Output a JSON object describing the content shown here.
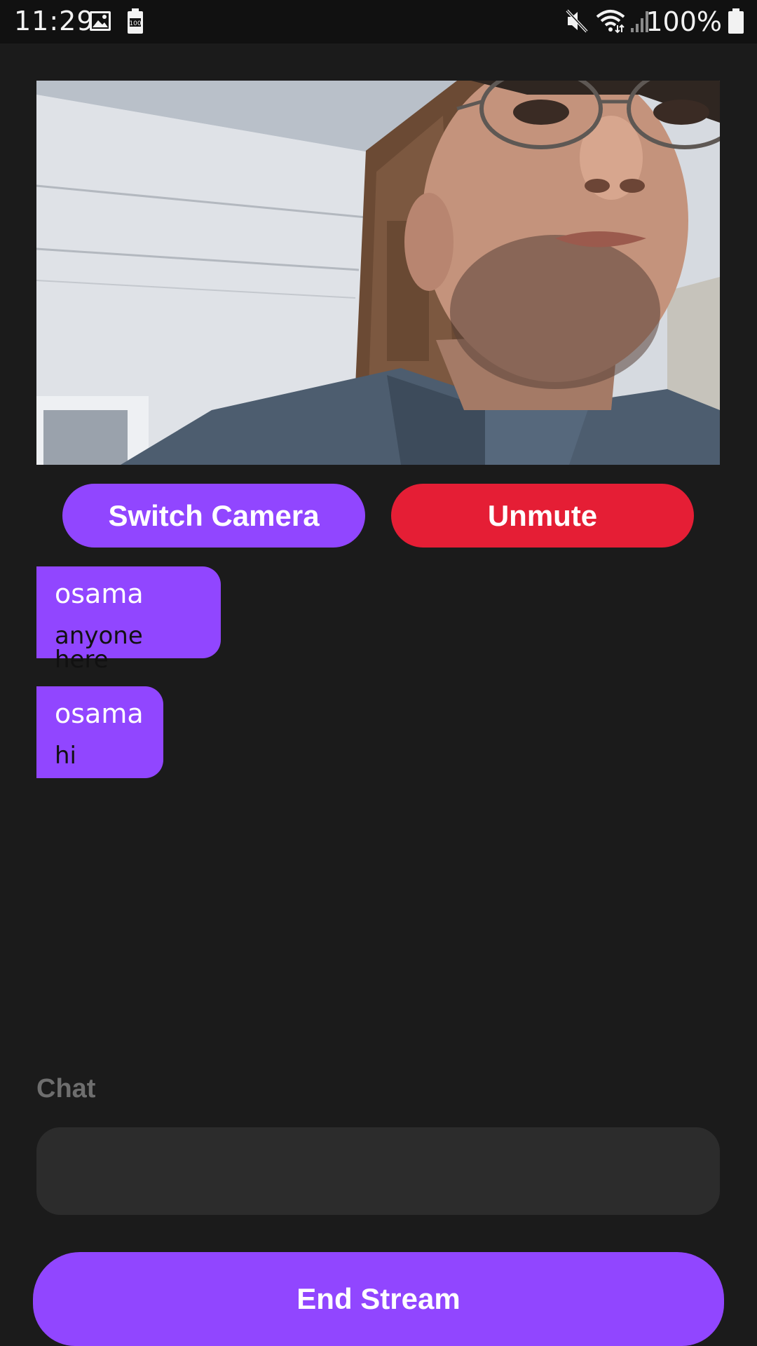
{
  "status_bar": {
    "time": "11:29",
    "battery_text": "100%",
    "icons": [
      "image-icon",
      "battery-saver-icon",
      "mute-icon",
      "wifi-icon",
      "signal-icon",
      "battery-icon"
    ]
  },
  "video": {
    "description_icon": "camera-feed"
  },
  "controls": {
    "switch_camera_label": "Switch Camera",
    "unmute_label": "Unmute"
  },
  "messages": [
    {
      "user": "osama",
      "text": "anyone here"
    },
    {
      "user": "osama",
      "text": "hi"
    }
  ],
  "chat": {
    "label": "Chat",
    "input_value": "",
    "input_placeholder": ""
  },
  "footer": {
    "end_stream_label": "End Stream"
  },
  "colors": {
    "background": "#1b1b1b",
    "accent": "#9146ff",
    "danger": "#e51e35",
    "input_bg": "#2c2c2c"
  }
}
